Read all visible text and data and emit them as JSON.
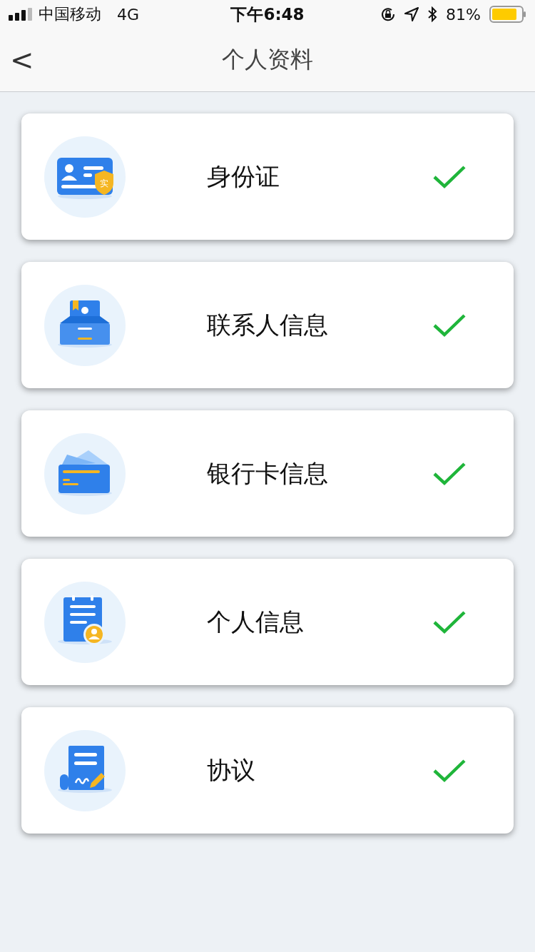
{
  "status_bar": {
    "carrier": "中国移动",
    "network": "4G",
    "time": "下午6:48",
    "battery": "81%"
  },
  "nav_bar": {
    "back": "<",
    "title": "个人资料"
  },
  "items": [
    {
      "kind": "id",
      "label": "身份证",
      "badge": "实",
      "done": true
    },
    {
      "kind": "contact",
      "label": "联系人信息",
      "done": true
    },
    {
      "kind": "bank",
      "label": "银行卡信息",
      "done": true
    },
    {
      "kind": "personal",
      "label": "个人信息",
      "done": true
    },
    {
      "kind": "agreement",
      "label": "协议",
      "done": true
    }
  ]
}
